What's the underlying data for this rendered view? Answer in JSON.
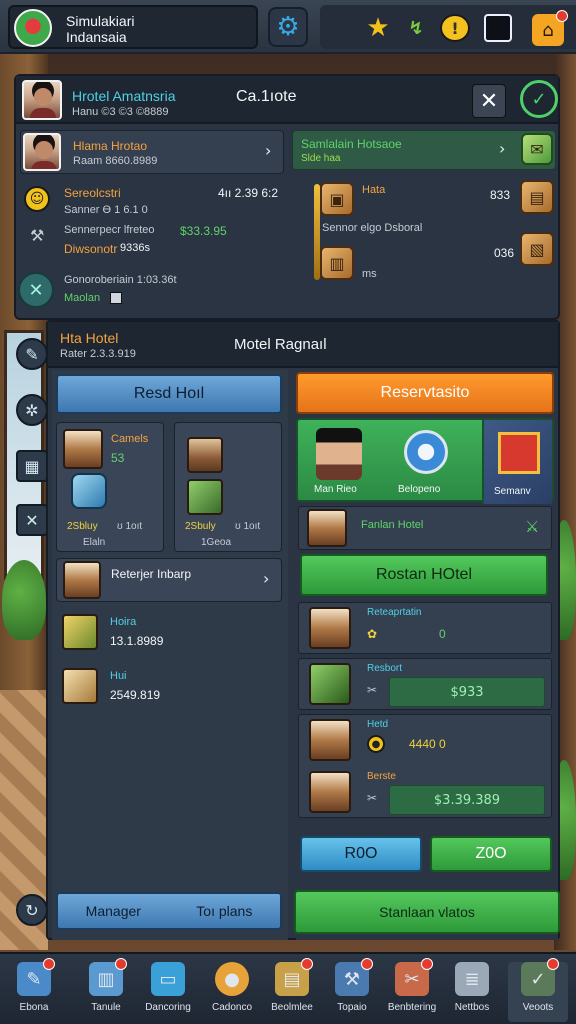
{
  "header": {
    "logo_line1": "Simulakiari",
    "logo_line2": "Indansaia"
  },
  "panel": {
    "title": "Ca.1ıote",
    "owner_name": "Hrotel Amatnsria",
    "owner_sub": "Hanu ©3 ©3 ©8889",
    "manager_name": "Hlama Hrotao",
    "manager_sub": "Raam 8660.8989",
    "green_card_title": "Samlalain Hotsaoe",
    "green_card_sub": "Slde haa",
    "stat1_label": "Sereolcstri",
    "stat1_value": "4ıı 2.39 6:2",
    "stat1_sub": "Sanner Ɵ 1 6.1 0",
    "stat2_label": "Sennerpecr lfreteo",
    "stat2_value": "$33.3.95",
    "stat3_label": "Diwsonotr",
    "stat3_value": "9336s",
    "stat4_label": "Gonoroberiain 1:03.36t",
    "stat4_sub": "Maolan",
    "item1_label": "Hata",
    "item1_value": "833",
    "item2_label": "Sennor elgo Dsboral",
    "item3_label": "ms",
    "item3_value": "036"
  },
  "section": {
    "left_title": "Hta Hotel",
    "left_sub": "Rater 2.3.3.919",
    "center_title": "Motel Ragnaıl"
  },
  "left": {
    "button": "Resd Hoıl",
    "tile1_label": "Camels",
    "tile1_value": "53",
    "tile1_foot": "2Sbluy",
    "tile1_foot2": "ʊ 1oıt",
    "tile1_foot3": "Elaln",
    "tile2_foot": "2Sbuly",
    "tile2_foot2": "ʊ 1oıt",
    "tile2_foot3": "1Geoa",
    "row_label": "Reterjer Inbarp",
    "item1_label": "Hoira",
    "item1_value": "13.1.8989",
    "item2_label": "Hui",
    "item2_value": "2549.819",
    "btn_manager": "Manager",
    "btn_tool": "Toı plans"
  },
  "right": {
    "button": "Reservtasito",
    "banner_a": "Man Rieo",
    "banner_b": "Belopeno",
    "banner_c": "Semanv",
    "row1_label": "Fanlan Hotel",
    "big_btn": "Rostan HOtel",
    "list1_label": "Reteaprtatin",
    "list1_value": "0",
    "list2_label": "Resbort",
    "list2_value": "$933",
    "list3_label": "Hetd",
    "list3_value": "4440 0",
    "list4_label": "Berste",
    "list4_value": "$3.39.389",
    "btn_a": "R0O",
    "btn_b": "Z0O",
    "bottom_btn": "Stanlaan vlatos"
  },
  "nav": [
    {
      "label": "Ebona",
      "icon": "pencil-icon"
    },
    {
      "label": "Tanule",
      "icon": "book-icon"
    },
    {
      "label": "Dancoring",
      "icon": "card-icon"
    },
    {
      "label": "Cadonco",
      "icon": "coin-icon"
    },
    {
      "label": "Beolmlee",
      "icon": "clipboard-icon"
    },
    {
      "label": "Topaio",
      "icon": "hammer-icon"
    },
    {
      "label": "Benbtering",
      "icon": "tools-icon"
    },
    {
      "label": "Nettbos",
      "icon": "stack-icon"
    },
    {
      "label": "Veoots",
      "icon": "check-icon"
    }
  ],
  "colors": {
    "accent_orange": "#f4a340",
    "accent_green": "#3fb25a",
    "accent_blue": "#6ea7d8",
    "panel_bg": "#2a3442"
  }
}
